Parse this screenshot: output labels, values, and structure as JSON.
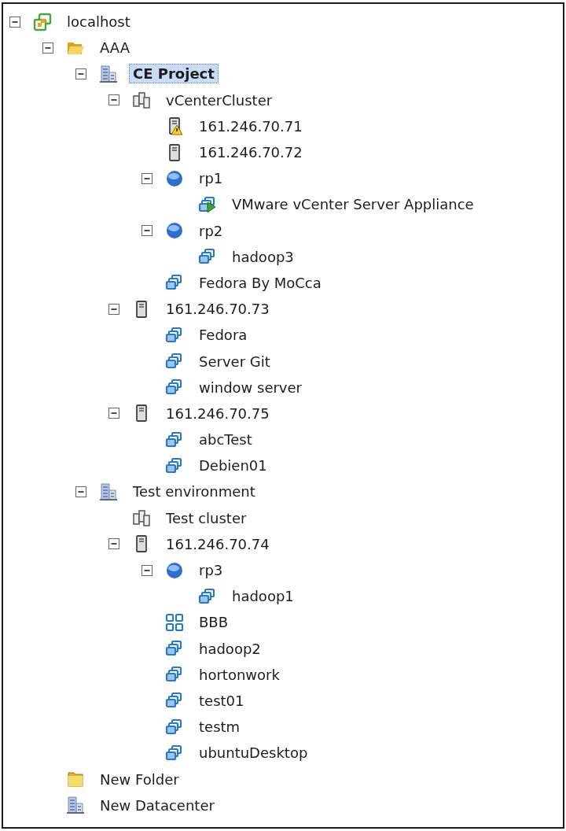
{
  "tree": [
    {
      "label": "localhost",
      "kind": "vcenter",
      "expanded": true,
      "selected": false,
      "children": [
        {
          "label": "AAA",
          "kind": "folder-open",
          "expanded": true,
          "selected": false,
          "children": [
            {
              "label": "CE Project",
              "kind": "datacenter",
              "expanded": true,
              "selected": true,
              "children": [
                {
                  "label": "vCenterCluster",
                  "kind": "cluster",
                  "expanded": true,
                  "selected": false,
                  "children": [
                    {
                      "label": "161.246.70.71",
                      "kind": "host-warning",
                      "selected": false
                    },
                    {
                      "label": "161.246.70.72",
                      "kind": "host",
                      "selected": false
                    },
                    {
                      "label": "rp1",
                      "kind": "resource-pool",
                      "expanded": true,
                      "selected": false,
                      "children": [
                        {
                          "label": "VMware vCenter Server Appliance",
                          "kind": "appliance",
                          "selected": false
                        }
                      ]
                    },
                    {
                      "label": "rp2",
                      "kind": "resource-pool",
                      "expanded": true,
                      "selected": false,
                      "children": [
                        {
                          "label": "hadoop3",
                          "kind": "vm",
                          "selected": false
                        }
                      ]
                    },
                    {
                      "label": "Fedora By MoCca",
                      "kind": "vm",
                      "selected": false
                    }
                  ]
                },
                {
                  "label": "161.246.70.73",
                  "kind": "host",
                  "expanded": true,
                  "selected": false,
                  "children": [
                    {
                      "label": "Fedora",
                      "kind": "vm",
                      "selected": false
                    },
                    {
                      "label": "Server Git",
                      "kind": "vm",
                      "selected": false
                    },
                    {
                      "label": "window server",
                      "kind": "vm",
                      "selected": false
                    }
                  ]
                },
                {
                  "label": "161.246.70.75",
                  "kind": "host",
                  "expanded": true,
                  "selected": false,
                  "children": [
                    {
                      "label": "abcTest",
                      "kind": "vm",
                      "selected": false
                    },
                    {
                      "label": "Debien01",
                      "kind": "vm",
                      "selected": false
                    }
                  ]
                }
              ]
            },
            {
              "label": "Test environment",
              "kind": "datacenter",
              "expanded": true,
              "selected": false,
              "children": [
                {
                  "label": "Test cluster",
                  "kind": "cluster",
                  "selected": false
                },
                {
                  "label": "161.246.70.74",
                  "kind": "host",
                  "expanded": true,
                  "selected": false,
                  "children": [
                    {
                      "label": "rp3",
                      "kind": "resource-pool",
                      "expanded": true,
                      "selected": false,
                      "children": [
                        {
                          "label": "hadoop1",
                          "kind": "vm",
                          "selected": false
                        }
                      ]
                    },
                    {
                      "label": "BBB",
                      "kind": "vapp",
                      "selected": false
                    },
                    {
                      "label": "hadoop2",
                      "kind": "vm",
                      "selected": false
                    },
                    {
                      "label": "hortonwork",
                      "kind": "vm",
                      "selected": false
                    },
                    {
                      "label": "test01",
                      "kind": "vm",
                      "selected": false
                    },
                    {
                      "label": "testm",
                      "kind": "vm",
                      "selected": false
                    },
                    {
                      "label": "ubuntuDesktop",
                      "kind": "vm",
                      "selected": false
                    }
                  ]
                }
              ]
            }
          ]
        },
        {
          "label": "New Folder",
          "kind": "folder",
          "selected": false
        },
        {
          "label": "New Datacenter",
          "kind": "datacenter",
          "selected": false
        }
      ]
    }
  ]
}
